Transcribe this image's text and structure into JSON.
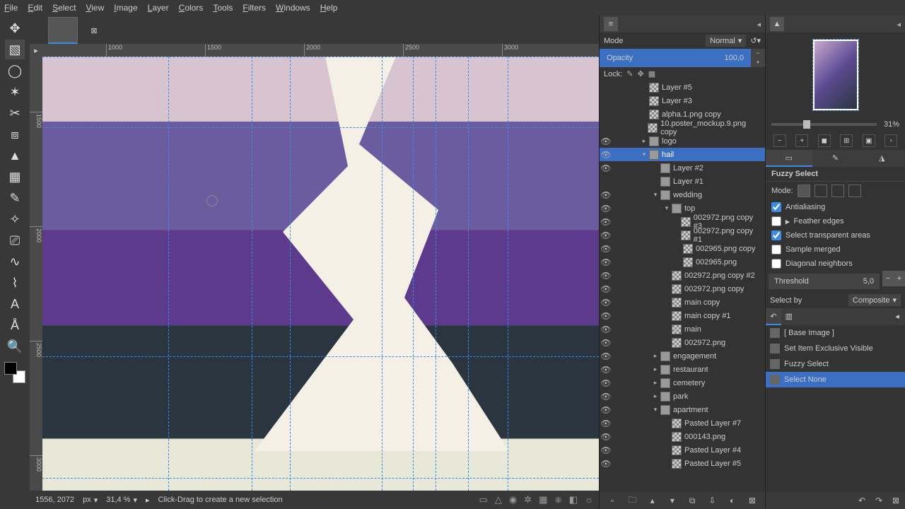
{
  "menu": [
    "File",
    "Edit",
    "Select",
    "View",
    "Image",
    "Layer",
    "Colors",
    "Tools",
    "Filters",
    "Windows",
    "Help"
  ],
  "ruler_h": [
    "1000",
    "1500",
    "2000",
    "2500",
    "3000"
  ],
  "ruler_v": [
    "1500",
    "2000",
    "2500",
    "3000"
  ],
  "mode_label": "Mode",
  "mode_value": "Normal",
  "opacity_label": "Opacity",
  "opacity_value": "100,0",
  "lock_label": "Lock:",
  "layers": [
    {
      "eye": false,
      "depth": 0,
      "tri": "",
      "checker": true,
      "name": "Layer #5"
    },
    {
      "eye": false,
      "depth": 0,
      "tri": "",
      "checker": true,
      "name": "Layer #3"
    },
    {
      "eye": false,
      "depth": 0,
      "tri": "",
      "checker": true,
      "name": "alpha.1.png copy"
    },
    {
      "eye": false,
      "depth": 0,
      "tri": "",
      "checker": true,
      "name": "10.poster_mockup.9.png copy"
    },
    {
      "eye": true,
      "depth": 0,
      "tri": "▸",
      "checker": false,
      "name": "logo"
    },
    {
      "eye": true,
      "depth": 0,
      "tri": "▾",
      "checker": false,
      "name": "hail",
      "selected": true
    },
    {
      "eye": true,
      "depth": 1,
      "tri": "",
      "checker": false,
      "name": "Layer #2"
    },
    {
      "eye": false,
      "depth": 1,
      "tri": "",
      "checker": false,
      "name": "Layer #1"
    },
    {
      "eye": true,
      "depth": 1,
      "tri": "▾",
      "checker": false,
      "name": "wedding"
    },
    {
      "eye": true,
      "depth": 2,
      "tri": "▾",
      "checker": false,
      "name": "top"
    },
    {
      "eye": true,
      "depth": 3,
      "tri": "",
      "checker": true,
      "name": "002972.png copy #3"
    },
    {
      "eye": true,
      "depth": 3,
      "tri": "",
      "checker": true,
      "name": "002972.png copy #1"
    },
    {
      "eye": true,
      "depth": 3,
      "tri": "",
      "checker": true,
      "name": "002965.png copy"
    },
    {
      "eye": true,
      "depth": 3,
      "tri": "",
      "checker": true,
      "name": "002965.png"
    },
    {
      "eye": true,
      "depth": 2,
      "tri": "",
      "checker": true,
      "name": "002972.png copy #2"
    },
    {
      "eye": true,
      "depth": 2,
      "tri": "",
      "checker": true,
      "name": "002972.png copy"
    },
    {
      "eye": true,
      "depth": 2,
      "tri": "",
      "checker": true,
      "name": "main copy"
    },
    {
      "eye": true,
      "depth": 2,
      "tri": "",
      "checker": true,
      "name": "main copy #1"
    },
    {
      "eye": true,
      "depth": 2,
      "tri": "",
      "checker": true,
      "name": "main"
    },
    {
      "eye": true,
      "depth": 2,
      "tri": "",
      "checker": true,
      "name": "002972.png"
    },
    {
      "eye": true,
      "depth": 1,
      "tri": "▸",
      "checker": false,
      "name": "engagement"
    },
    {
      "eye": true,
      "depth": 1,
      "tri": "▸",
      "checker": false,
      "name": "restaurant"
    },
    {
      "eye": true,
      "depth": 1,
      "tri": "▸",
      "checker": false,
      "name": "cemetery"
    },
    {
      "eye": true,
      "depth": 1,
      "tri": "▸",
      "checker": false,
      "name": "park"
    },
    {
      "eye": true,
      "depth": 1,
      "tri": "▾",
      "checker": false,
      "name": "apartment"
    },
    {
      "eye": true,
      "depth": 2,
      "tri": "",
      "checker": true,
      "name": "Pasted Layer #7"
    },
    {
      "eye": true,
      "depth": 2,
      "tri": "",
      "checker": true,
      "name": "000143.png"
    },
    {
      "eye": true,
      "depth": 2,
      "tri": "",
      "checker": true,
      "name": "Pasted Layer #4"
    },
    {
      "eye": true,
      "depth": 2,
      "tri": "",
      "checker": true,
      "name": "Pasted Layer #5"
    }
  ],
  "zoom_pct": "31%",
  "tool_title": "Fuzzy Select",
  "mode2": "Mode:",
  "checks": {
    "antialias": "Antialiasing",
    "feather": "Feather edges",
    "transp": "Select transparent areas",
    "sample": "Sample merged",
    "diag": "Diagonal neighbors"
  },
  "threshold_label": "Threshold",
  "threshold_val": "5,0",
  "selectby_label": "Select by",
  "selectby_val": "Composite",
  "history": [
    {
      "name": "[ Base Image ]"
    },
    {
      "name": "Set Item Exclusive Visible"
    },
    {
      "name": "Fuzzy Select"
    },
    {
      "name": "Select None",
      "selected": true
    }
  ],
  "status": {
    "coords": "1556, 2072",
    "unit": "px",
    "zoom": "31,4 %",
    "hint": "Click-Drag to create a new selection"
  }
}
